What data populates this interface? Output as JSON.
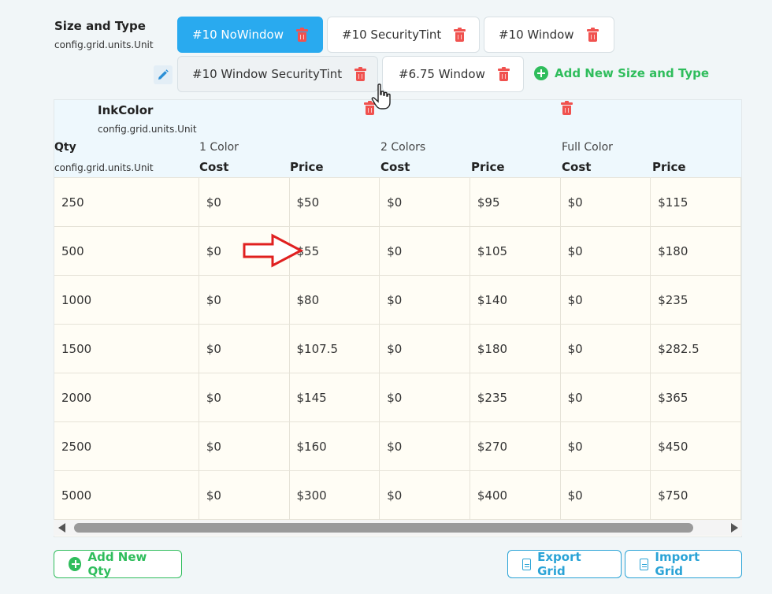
{
  "size_type": {
    "title": "Size and Type",
    "subtitle": "config.grid.units.Unit",
    "chips": [
      {
        "label": "#10 NoWindow",
        "state": "active"
      },
      {
        "label": "#10 SecurityTint",
        "state": "normal"
      },
      {
        "label": "#10 Window",
        "state": "normal"
      },
      {
        "label": "#10 Window SecurityTint",
        "state": "hover"
      },
      {
        "label": "#6.75 Window",
        "state": "normal"
      }
    ],
    "add_label": "Add New Size and Type"
  },
  "grid": {
    "ink_title": "InkColor",
    "ink_sub": "config.grid.units.Unit",
    "qty_label": "Qty",
    "qty_sub": "config.grid.units.Unit",
    "groups": [
      "1 Color",
      "2 Colors",
      "Full Color"
    ],
    "cost_label": "Cost",
    "price_label": "Price",
    "rows": [
      [
        "250",
        "$0",
        "$50",
        "$0",
        "$95",
        "$0",
        "$115"
      ],
      [
        "500",
        "$0",
        "$55",
        "$0",
        "$105",
        "$0",
        "$180"
      ],
      [
        "1000",
        "$0",
        "$80",
        "$0",
        "$140",
        "$0",
        "$235"
      ],
      [
        "1500",
        "$0",
        "$107.5",
        "$0",
        "$180",
        "$0",
        "$282.5"
      ],
      [
        "2000",
        "$0",
        "$145",
        "$0",
        "$235",
        "$0",
        "$365"
      ],
      [
        "2500",
        "$0",
        "$160",
        "$0",
        "$270",
        "$0",
        "$450"
      ],
      [
        "5000",
        "$0",
        "$300",
        "$0",
        "$400",
        "$0",
        "$750"
      ]
    ]
  },
  "footer": {
    "add_qty": "Add New Qty",
    "export": "Export Grid",
    "import": "Import Grid"
  },
  "colors": {
    "accent_blue": "#29aaef",
    "green": "#2fbd5c",
    "delete_red": "#f0524f",
    "annotation_red": "#e02020"
  }
}
